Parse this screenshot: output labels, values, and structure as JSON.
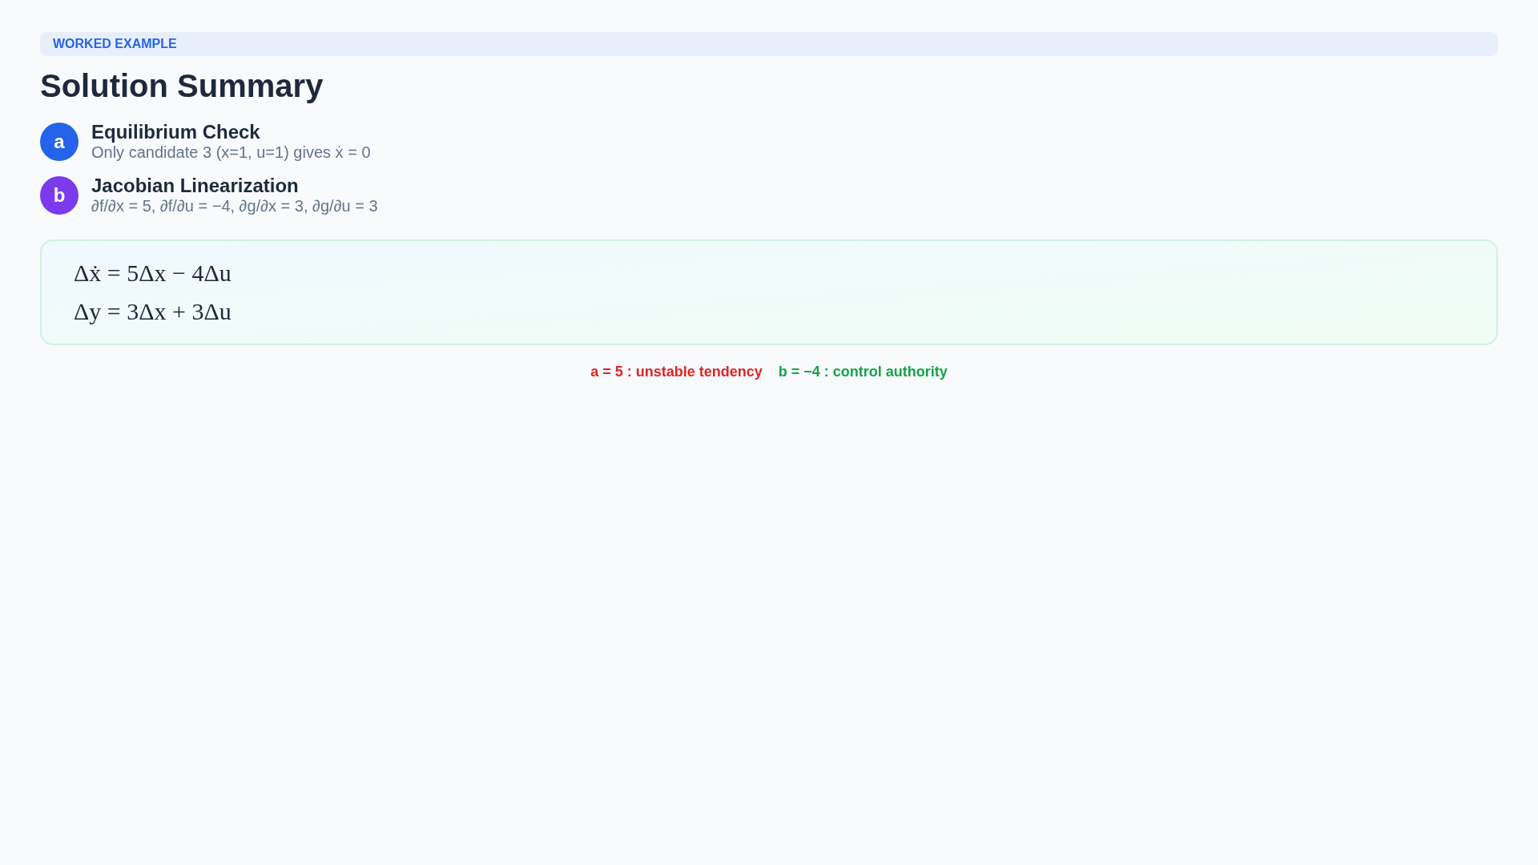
{
  "banner": {
    "label": "WORKED EXAMPLE"
  },
  "title": "Solution Summary",
  "steps": [
    {
      "badge": "a",
      "color": "#2563eb",
      "title": "Equilibrium Check",
      "detail": "Only candidate 3 (x=1, u=1) gives ẋ = 0"
    },
    {
      "badge": "b",
      "color": "#7c3aed",
      "title": "Jacobian Linearization",
      "detail": "∂f/∂x = 5, ∂f/∂u = −4, ∂g/∂x = 3, ∂g/∂u = 3"
    }
  ],
  "equations": [
    "Δẋ = 5Δx − 4Δu",
    "Δy = 3Δx + 3Δu"
  ],
  "notes": [
    {
      "text": "a = 5 : unstable tendency",
      "color": "#dc2626"
    },
    {
      "text": "b = −4 : control authority",
      "color": "#16a34a"
    }
  ]
}
